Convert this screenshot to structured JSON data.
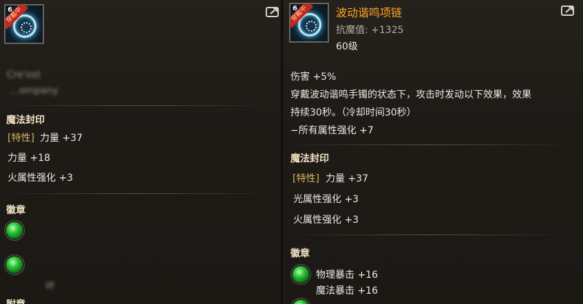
{
  "left": {
    "icon_badge": "穿戴中",
    "icon_grade": "6",
    "blurred_line1": "Cre'ost",
    "blurred_line2": "…ompany",
    "seal_title": "魔法封印",
    "trait_tag": "[特性]",
    "trait_stat": "力量 +37",
    "stat_1": "力量 +18",
    "stat_2": "火属性强化 +3",
    "emblem_title": "徽章",
    "blurred_bottom": "坏",
    "next_title": "附章"
  },
  "right": {
    "icon_badge": "穿戴中",
    "icon_grade": "6",
    "item_name": "波动谐鸣项链",
    "magic_resist": "抗魔值: +1325",
    "level": "60级",
    "damage": "伤害 +5%",
    "desc_line1": "穿戴波动谐鸣手镯的状态下，攻击时发动以下效果，效果",
    "desc_line2": "持续30秒。（冷却时间30秒）",
    "desc_line3": "−所有属性强化 +7",
    "seal_title": "魔法封印",
    "trait_tag": "[特性]",
    "trait_stat": "力量 +37",
    "stat_1": "光属性强化 +3",
    "stat_2": "火属性强化 +3",
    "emblem_title": "徽章",
    "emblem_stat_1": "物理暴击 +16",
    "emblem_stat_2": "魔法暴击 +16"
  },
  "icons": {
    "share": "share-icon",
    "emblem": "green-emblem-icon"
  },
  "colors": {
    "item_name": "#ffa726",
    "section": "#f0e2c3",
    "bracket": "#d7b85f",
    "badge": "#c3271d"
  }
}
